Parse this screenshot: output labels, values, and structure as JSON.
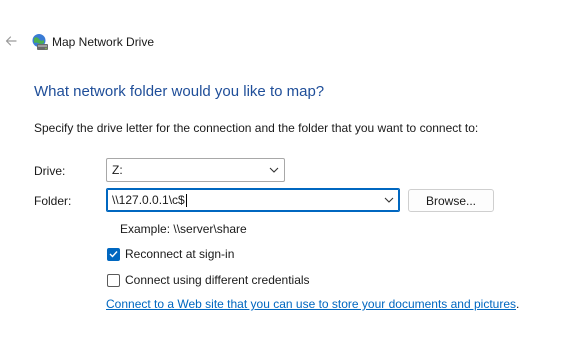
{
  "window": {
    "title": "Map Network Drive"
  },
  "heading": "What network folder would you like to map?",
  "instruction": "Specify the drive letter for the connection and the folder that you want to connect to:",
  "drive": {
    "label": "Drive:",
    "value": "Z:"
  },
  "folder": {
    "label": "Folder:",
    "value": "\\\\127.0.0.1\\c$"
  },
  "browse_label": "Browse...",
  "example": "Example: \\\\server\\share",
  "reconnect": {
    "label": "Reconnect at sign-in",
    "checked": true
  },
  "credentials": {
    "label": "Connect using different credentials",
    "checked": false
  },
  "web_link": {
    "text": "Connect to a Web site that you can use to store your documents and pictures",
    "suffix": "."
  },
  "colors": {
    "accent": "#0067c0",
    "heading": "#1f4e99"
  },
  "icons": [
    "back-arrow-icon",
    "network-drive-icon",
    "chevron-down-icon",
    "checkmark-icon"
  ]
}
